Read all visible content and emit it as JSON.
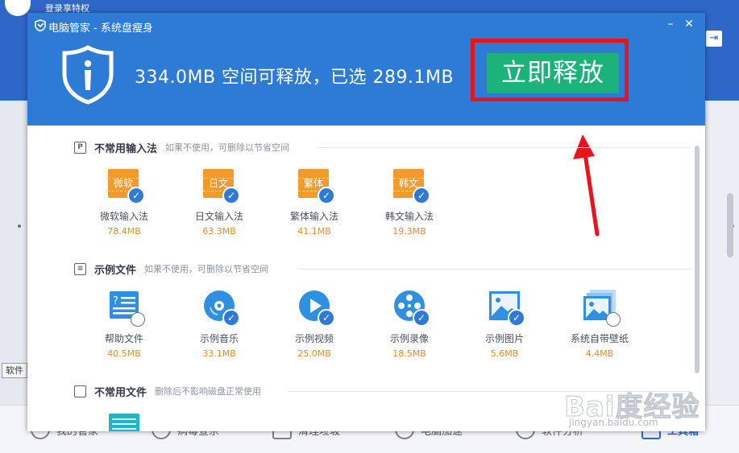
{
  "background_window": {
    "top_link": "登录享特权",
    "tooltip": "软件",
    "nav": [
      {
        "label": "我的管家",
        "icon": "home-shield-icon"
      },
      {
        "label": "病毒查杀",
        "icon": "virus-scan-icon"
      },
      {
        "label": "清理垃圾",
        "icon": "broom-icon"
      },
      {
        "label": "电脑加速",
        "icon": "rocket-icon"
      },
      {
        "label": "软件分析",
        "icon": "software-analysis-icon"
      },
      {
        "label": "工具箱",
        "icon": "toolbox-icon",
        "active": true
      }
    ]
  },
  "dialog": {
    "title": "电脑管家 - 系统盘瘦身",
    "headline": "334.0MB 空间可释放，已选 289.1MB",
    "release_button": "立即释放",
    "colors": {
      "header": "#2e7bd6",
      "button": "#1bb37a",
      "highlight": "#e8141c",
      "size_text": "#e38d2c"
    },
    "sections": [
      {
        "icon": "P",
        "title": "不常用输入法",
        "desc": "如果不使用，可删除以节省空间",
        "items": [
          {
            "icon_text": "微软",
            "name": "微软输入法",
            "size": "78.4MB",
            "checked": true
          },
          {
            "icon_text": "日文",
            "name": "日文输入法",
            "size": "63.3MB",
            "checked": true
          },
          {
            "icon_text": "繁体",
            "name": "繁体输入法",
            "size": "41.1MB",
            "checked": true
          },
          {
            "icon_text": "韩文",
            "name": "韩文输入法",
            "size": "19.3MB",
            "checked": true
          }
        ]
      },
      {
        "title": "示例文件",
        "desc": "如果不使用，可删除以节省空间",
        "items": [
          {
            "icon": "help-file-icon",
            "name": "帮助文件",
            "size": "40.5MB",
            "checked": false
          },
          {
            "icon": "music-disc-icon",
            "name": "示例音乐",
            "size": "33.1MB",
            "checked": true
          },
          {
            "icon": "video-play-icon",
            "name": "示例视频",
            "size": "25.0MB",
            "checked": true
          },
          {
            "icon": "film-reel-icon",
            "name": "示例录像",
            "size": "18.5MB",
            "checked": true
          },
          {
            "icon": "picture-icon",
            "name": "示例图片",
            "size": "5.6MB",
            "checked": true
          },
          {
            "icon": "wallpaper-icon",
            "name": "系统自带壁纸",
            "size": "4.4MB",
            "checked": false
          }
        ]
      },
      {
        "title": "不常用文件",
        "desc": "删除后不影响磁盘正常使用"
      }
    ]
  },
  "watermark": {
    "main": "Bai度经验",
    "sub": "jingyan.baidu.com"
  }
}
